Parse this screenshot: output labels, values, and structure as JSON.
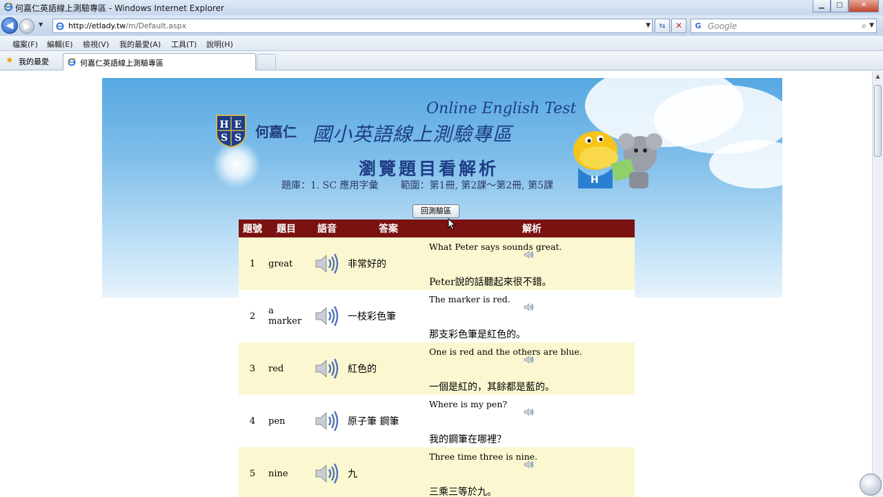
{
  "window": {
    "title": "何嘉仁英語線上測驗專區 - Windows Internet Explorer",
    "min": "▁",
    "max": "□",
    "close": "✕"
  },
  "nav": {
    "back": "◀",
    "forward": "▶",
    "address_host": "http://etlady.tw",
    "address_path": "/m/Default.aspx",
    "search_placeholder": "Google",
    "search_engine_glyph": "G"
  },
  "menu": [
    "檔案(F)",
    "編輯(E)",
    "檢視(V)",
    "我的最愛(A)",
    "工具(T)",
    "說明(H)"
  ],
  "favorites": {
    "label": "我的最愛",
    "tab_title": "何嘉仁英語線上測驗專區"
  },
  "banner": {
    "brand": "何嘉仁",
    "main_title": "國小英語線上測驗專區",
    "tagline": "Online English Test",
    "sub_title": "瀏覽題目看解析",
    "bank": "題庫：1. SC 應用字彙",
    "range": "範圍：第1冊, 第2課～第2冊, 第5課",
    "logo_letters": [
      "H",
      "E",
      "S",
      "S"
    ]
  },
  "back_button": "回測驗區",
  "table": {
    "headers": [
      "題號",
      "題目",
      "語音",
      "答案",
      "解析"
    ],
    "rows": [
      {
        "no": "1",
        "word": "great",
        "answer": "非常好的",
        "exp_en": "What Peter says sounds great.",
        "exp_zh": "Peter說的話聽起來很不錯。"
      },
      {
        "no": "2",
        "word": "a marker",
        "answer": "一枝彩色筆",
        "exp_en": "The marker is red.",
        "exp_zh": "那支彩色筆是紅色的。"
      },
      {
        "no": "3",
        "word": "red",
        "answer": "紅色的",
        "exp_en": "One is red and the others are blue.",
        "exp_zh": "一個是紅的，其餘都是藍的。"
      },
      {
        "no": "4",
        "word": "pen",
        "answer": "原子筆 鋼筆",
        "exp_en": "Where is my pen?",
        "exp_zh": "我的鋼筆在哪裡？"
      },
      {
        "no": "5",
        "word": "nine",
        "answer": "九",
        "exp_en": "Three time three is nine.",
        "exp_zh": "三乘三等於九。"
      }
    ]
  },
  "colors": {
    "header_bg": "#7b1212",
    "odd_row": "#fbf8d1",
    "banner_top": "#57a8e2"
  }
}
